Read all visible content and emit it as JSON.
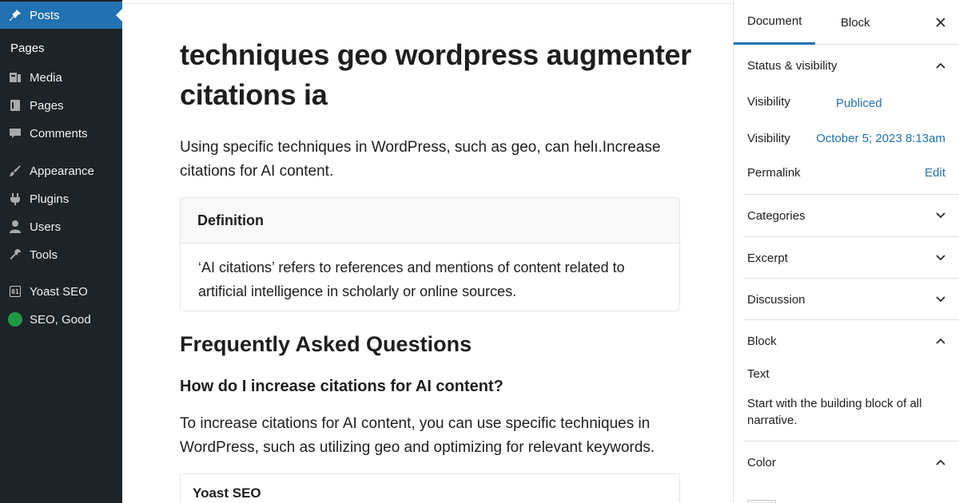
{
  "sidebar": {
    "items": [
      {
        "label": "Posts",
        "icon": "pin-icon"
      },
      {
        "label": "Media",
        "icon": "media-icon"
      },
      {
        "label": "Pages",
        "icon": "pages-icon"
      },
      {
        "label": "Comments",
        "icon": "comments-icon"
      },
      {
        "label": "Appearance",
        "icon": "brush-icon"
      },
      {
        "label": "Plugins",
        "icon": "plug-icon"
      },
      {
        "label": "Users",
        "icon": "user-icon"
      },
      {
        "label": "Tools",
        "icon": "wrench-icon"
      },
      {
        "label": "Yoast SEO",
        "icon": "yoast-icon"
      },
      {
        "label": "SEO, Good",
        "icon": "seo-status-dot-icon"
      }
    ],
    "submenu_label": "Pages",
    "accent_color": "#2271b1",
    "background_color": "#1d2327",
    "seo_status_color": "#1e9a47"
  },
  "editor": {
    "title": "techniques geo wordpress augmenter citations ia",
    "intro": "Using specific techniques in WordPress, such as geo, can helı.Increase citations for AI content.",
    "definition": {
      "heading": "Definition",
      "body": "‘AI citations’ refers to references and mentions of content related to artificial intelligence in scholarly or online sources."
    },
    "faq": {
      "heading": "Frequently Asked Questions",
      "question": "How do I increase citations for AI content?",
      "answer": "To increase citations for AI content, you can use specific techniques in WordPress, such as utilizing geo and optimizing for relevant keywords."
    },
    "yoast_box_label": "Yoast SEO"
  },
  "panel": {
    "tabs": [
      "Document",
      "Block"
    ],
    "active_tab": "Document",
    "status": {
      "heading": "Status & visibility",
      "visibility_label": "Visibility",
      "visibility_value": "Publiced",
      "date_label": "Visibility",
      "date_value": "October 5; 2023 8:13am",
      "permalink_label": "Permalink",
      "permalink_action": "Edit"
    },
    "sections": [
      "Categories",
      "Excerpt",
      "Discussion"
    ],
    "block": {
      "heading": "Block",
      "type": "Text",
      "description": "Start with the building block of all narrative."
    },
    "color_heading": "Color",
    "link_color": "#2271b1"
  }
}
